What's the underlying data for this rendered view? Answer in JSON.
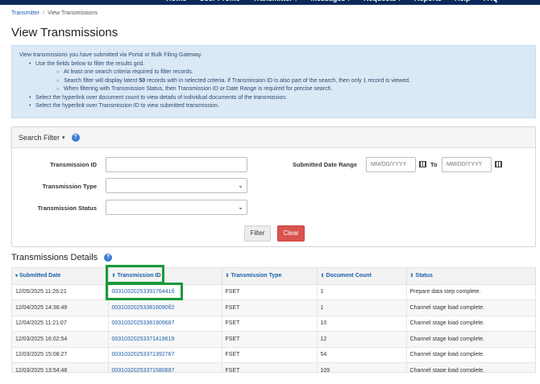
{
  "nav": {
    "items": [
      {
        "label": "Home",
        "has_menu": false
      },
      {
        "label": "User Profile",
        "has_menu": false
      },
      {
        "label": "Transmitter",
        "has_menu": true
      },
      {
        "label": "Messages",
        "has_menu": true
      },
      {
        "label": "Requests",
        "has_menu": true
      },
      {
        "label": "Reports",
        "has_menu": false
      },
      {
        "label": "Help",
        "has_menu": false
      },
      {
        "label": "FAQ",
        "has_menu": false
      }
    ],
    "caret": "▾"
  },
  "breadcrumb": {
    "parent": "Transmitter",
    "separator": "/",
    "current": "View Transmissions"
  },
  "page_title": "View Transmissions",
  "info": {
    "intro": "View transmissions you have submitted via Portal or Bulk Filing Gateway.",
    "bullet1": "Use the fields below to filter the results grid.",
    "sub1": "At least one search criteria required to filter records.",
    "sub2_pre": "Search filter will display latest ",
    "sub2_bold": "50",
    "sub2_post": " records with in selected criteria. If Transmission ID is also part of the search, then only 1 record is viewed.",
    "sub3": "When filtering with Transmission Status, then Transmission ID or Date Range is required for precise search.",
    "bullet2": "Select the hyperlink over document count to view details of individual documents of the transmission.",
    "bullet3": "Select the hyperlink over Transmission ID to view submitted transmission."
  },
  "filter": {
    "header": "Search Filter",
    "caret": "▾",
    "help_glyph": "?",
    "transmission_id_label": "Transmission ID",
    "transmission_id_value": "",
    "transmission_type_label": "Transmission Type",
    "transmission_type_value": "",
    "transmission_status_label": "Transmission Status",
    "transmission_status_value": "",
    "date_range_label": "Submitted Date Range",
    "date_from_placeholder": "MM/DD/YYYY",
    "to_label": "To",
    "date_to_placeholder": "MM/DD/YYYY",
    "filter_button": "Filter",
    "clear_button": "Clear"
  },
  "details": {
    "title": "Transmissions Details",
    "help_glyph": "?",
    "columns": [
      {
        "label": "Submitted Date",
        "arrow": "▾"
      },
      {
        "label": "Transmission ID",
        "arrow": "⇕"
      },
      {
        "label": "Transmission Type",
        "arrow": "⇕"
      },
      {
        "label": "Document Count",
        "arrow": "⇕"
      },
      {
        "label": "Status",
        "arrow": "⇕"
      }
    ],
    "rows": [
      {
        "date": "12/05/2025 11:26:21",
        "id": "0031032025339176441б",
        "type": "FSET",
        "count": "1",
        "status": "Prepare data step complete."
      },
      {
        "date": "12/04/2025 14:36:49",
        "id": "003103202533816090б2",
        "type": "FSET",
        "count": "1",
        "status": "Channel stage load complete."
      },
      {
        "date": "12/04/2025 11:21:07",
        "id": "00310320253381909687",
        "type": "FSET",
        "count": "10",
        "status": "Channel stage load complete."
      },
      {
        "date": "12/03/2025 16:02:54",
        "id": "00310320253371419619",
        "type": "FSET",
        "count": "12",
        "status": "Channel stage load complete."
      },
      {
        "date": "12/03/2025 15:08:27",
        "id": "00310320253371392767",
        "type": "FSET",
        "count": "54",
        "status": "Channel stage load complete."
      },
      {
        "date": "12/03/2025 13:54:48",
        "id": "00310320253371580887",
        "type": "FSET",
        "count": "109",
        "status": "Channel stage load complete."
      }
    ]
  },
  "colors": {
    "nav_bg": "#0b2a5b",
    "link": "#1a5fa8",
    "clear_button": "#d9534f",
    "highlight": "#1a9a3a",
    "info_bg": "#dbe9f6"
  }
}
